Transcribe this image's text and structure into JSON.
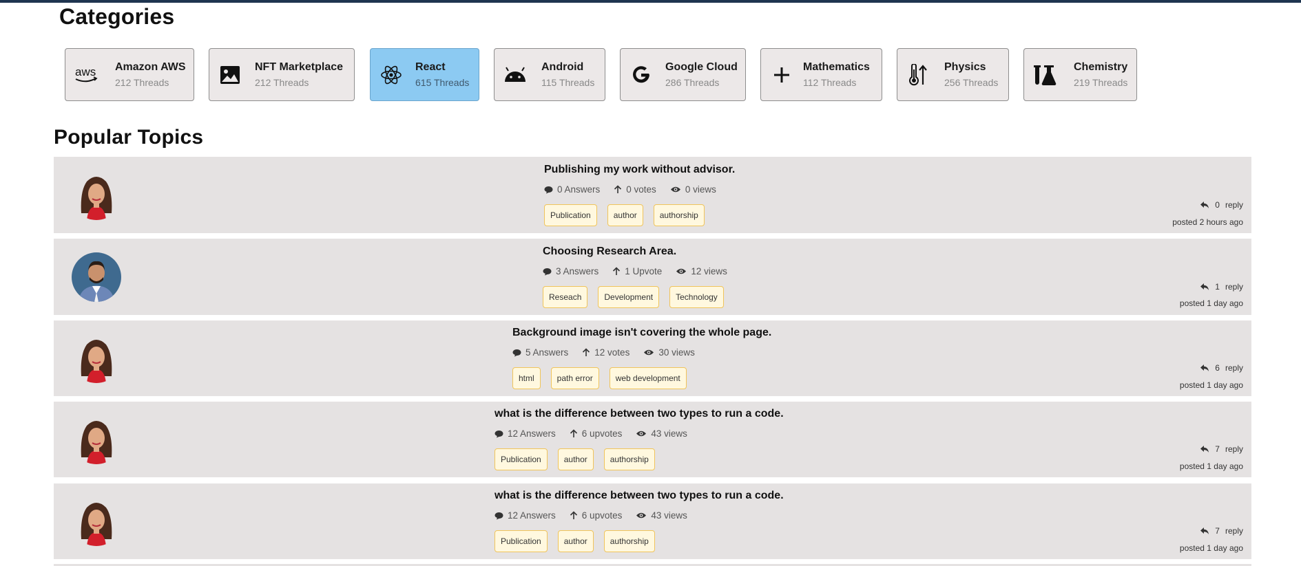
{
  "categories_heading": "Categories",
  "popular_heading": "Popular Topics",
  "colors": {
    "topbar": "#1f3550",
    "active_category": "#8ccaf2",
    "card": "#ece8e8",
    "row": "#e5e2e2",
    "tag_border": "#f0c45a",
    "tag_bg": "#fff8df"
  },
  "categories": [
    {
      "name": "Amazon AWS",
      "count": "212 Threads",
      "icon": "aws-logo-icon"
    },
    {
      "name": "NFT Marketplace",
      "count": "212 Threads",
      "icon": "image-icon"
    },
    {
      "name": "React",
      "count": "615 Threads",
      "icon": "react-atom-icon",
      "active": true
    },
    {
      "name": "Android",
      "count": "115 Threads",
      "icon": "android-icon"
    },
    {
      "name": "Google Cloud",
      "count": "286 Threads",
      "icon": "google-g-icon"
    },
    {
      "name": "Mathematics",
      "count": "112 Threads",
      "icon": "plus-icon"
    },
    {
      "name": "Physics",
      "count": "256 Threads",
      "icon": "thermometer-arrow-icon"
    },
    {
      "name": "Chemistry",
      "count": "219 Threads",
      "icon": "flasks-icon"
    }
  ],
  "topics": [
    {
      "title": "Publishing my work without advisor.",
      "answers": "0 Answers",
      "votes": "0 votes",
      "views": "0 views",
      "tags": [
        "Publication",
        "author",
        "authorship"
      ],
      "replies": "0",
      "reply_label": "reply",
      "posted": "posted 2 hours ago",
      "avatar": "woman-avatar"
    },
    {
      "title": "Choosing Research Area.",
      "answers": "3 Answers",
      "votes": "1 Upvote",
      "views": "12 views",
      "tags": [
        "Reseach",
        "Development",
        "Technology"
      ],
      "replies": "1",
      "reply_label": "reply",
      "posted": "posted 1 day ago",
      "avatar": "man-avatar"
    },
    {
      "title": "Background image isn't covering the whole page.",
      "answers": "5 Answers",
      "votes": "12 votes",
      "views": "30 views",
      "tags": [
        "html",
        "path error",
        "web development"
      ],
      "replies": "6",
      "reply_label": "reply",
      "posted": "posted 1 day ago",
      "avatar": "woman-avatar"
    },
    {
      "title": "what is the difference between two types to run a code.",
      "answers": "12 Answers",
      "votes": "6 upvotes",
      "views": "43 views",
      "tags": [
        "Publication",
        "author",
        "authorship"
      ],
      "replies": "7",
      "reply_label": "reply",
      "posted": "posted 1 day ago",
      "avatar": "woman-avatar"
    },
    {
      "title": "what is the difference between two types to run a code.",
      "answers": "12 Answers",
      "votes": "6 upvotes",
      "views": "43 views",
      "tags": [
        "Publication",
        "author",
        "authorship"
      ],
      "replies": "7",
      "reply_label": "reply",
      "posted": "posted 1 day ago",
      "avatar": "woman-avatar"
    }
  ]
}
